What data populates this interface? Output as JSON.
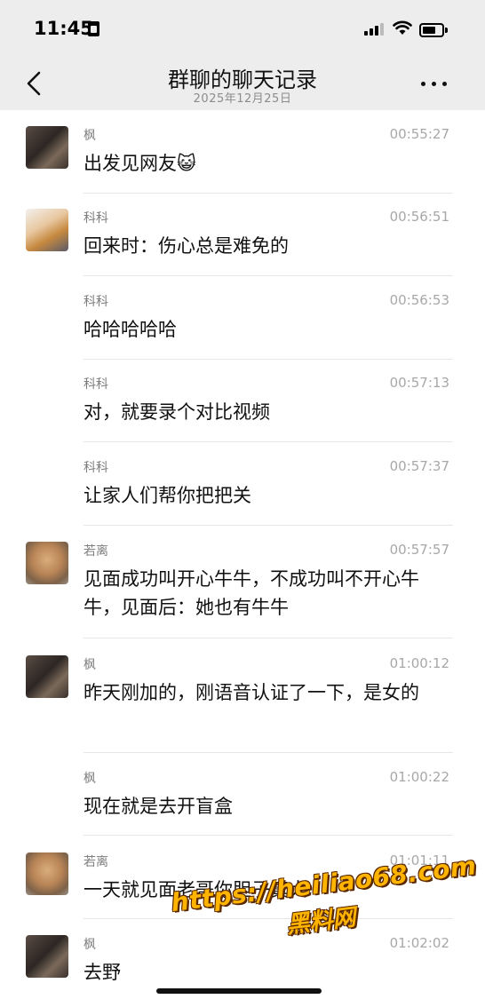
{
  "status_bar": {
    "time": "11:45",
    "icons": [
      "sim-card-icon",
      "cellular-signal-icon",
      "wifi-icon",
      "battery-icon"
    ]
  },
  "navbar": {
    "title": "群聊的聊天记录",
    "subtitle": "2025年12月25日",
    "back_icon": "chevron-left-icon",
    "more_icon": "more-dots-icon"
  },
  "messages": [
    {
      "sender": "枫",
      "time": "00:55:27",
      "text": "出发见网友😺",
      "avatar": "feng"
    },
    {
      "sender": "科科",
      "time": "00:56:51",
      "text": "回来时：伤心总是难免的",
      "avatar": "keke"
    },
    {
      "sender": "科科",
      "time": "00:56:53",
      "text": "哈哈哈哈哈",
      "avatar": ""
    },
    {
      "sender": "科科",
      "time": "00:57:13",
      "text": "对，就要录个对比视频",
      "avatar": ""
    },
    {
      "sender": "科科",
      "time": "00:57:37",
      "text": "让家人们帮你把把关",
      "avatar": ""
    },
    {
      "sender": "若离",
      "time": "00:57:57",
      "text": "见面成功叫开心牛牛，不成功叫不开心牛牛，见面后：她也有牛牛",
      "avatar": "ruoli"
    },
    {
      "sender": "枫",
      "time": "01:00:12",
      "text": "昨天刚加的，刚语音认证了一下，是女的",
      "avatar": "feng"
    },
    {
      "sender": "枫",
      "time": "01:00:22",
      "text": "现在就是去开盲盒",
      "avatar": ""
    },
    {
      "sender": "若离",
      "time": "01:01:11",
      "text": "一天就见面老哥你胆子真大",
      "avatar": "ruoli"
    },
    {
      "sender": "枫",
      "time": "01:02:02",
      "text": "去野",
      "avatar": "feng"
    }
  ],
  "watermark": {
    "url": "https://heiliao68.com",
    "name": "黑料网"
  },
  "colors": {
    "header_bg": "#ededed",
    "page_bg": "#ffffff",
    "watermark": "#ffb400"
  }
}
